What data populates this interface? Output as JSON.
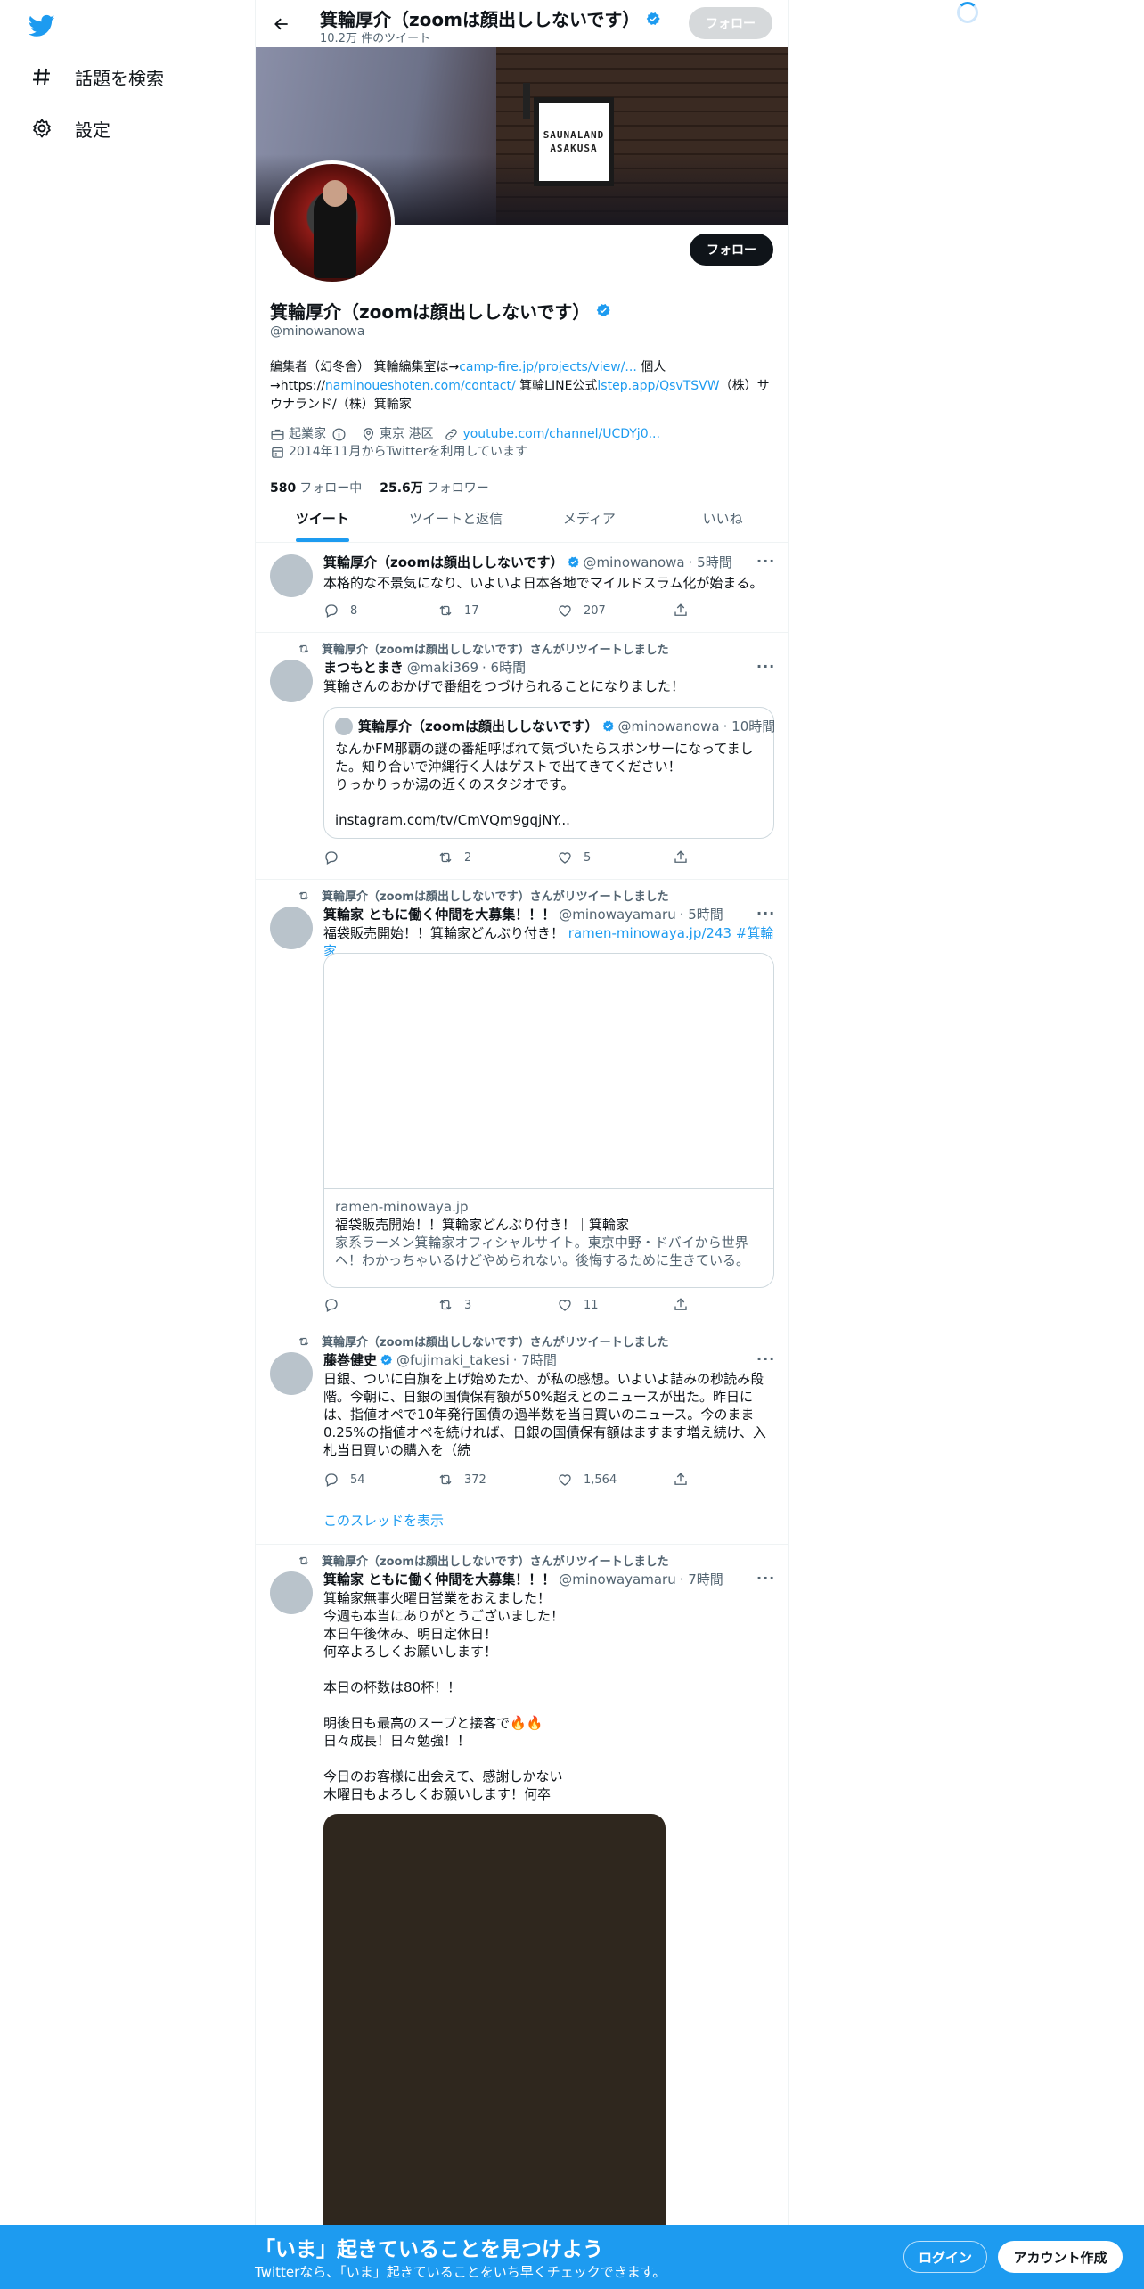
{
  "nav": {
    "items": [
      {
        "label": "話題を検索",
        "icon": "hashtag-icon"
      },
      {
        "label": "設定",
        "icon": "gear-icon"
      }
    ]
  },
  "header": {
    "name": "箕輪厚介（zoomは顔出ししないです）",
    "tweet_count": "10.2万 件のツイート",
    "follow_label": "フォロー"
  },
  "banner": {
    "sign_line1": "SAUNALAND",
    "sign_line2": "ASAKUSA"
  },
  "profile": {
    "follow_label": "フォロー",
    "name": "箕輪厚介（zoomは顔出ししないです）",
    "handle": "@minowanowa",
    "bio": {
      "p1": "編集者（幻冬舎） 箕輪編集室は→",
      "link1": "camp-fire.jp/projects/view/...",
      "p2": " 個人→https://",
      "link2": "naminoueshoten.com/contact/",
      "p3": " 箕輪LINE公式",
      "link3": "lstep.app/QsvTSVW",
      "p4": "（株）サウナランド/（株）箕輪家"
    },
    "category": "起業家",
    "location": "東京 港区",
    "url": "youtube.com/channel/UCDYj0...",
    "joined": "2014年11月からTwitterを利用しています",
    "following_count": "580",
    "following_label": "フォロー中",
    "followers_count": "25.6万",
    "followers_label": "フォロワー"
  },
  "tabs": [
    "ツイート",
    "ツイートと返信",
    "メディア",
    "いいね"
  ],
  "tweets": [
    {
      "name": "箕輪厚介（zoomは顔出ししないです）",
      "handle": "@minowanowa",
      "time": "· 5時間",
      "text": "本格的な不景気になり、いよいよ日本各地でマイルドスラム化が始まる。",
      "replies": "8",
      "retweets": "17",
      "likes": "207"
    },
    {
      "retweeted_by": "箕輪厚介（zoomは顔出ししないです）さんがリツイートしました",
      "name": "まつもとまき",
      "handle": "@maki369",
      "time": "· 6時間",
      "text": "箕輪さんのおかげで番組をつづけられることになりました！",
      "quote": {
        "name": "箕輪厚介（zoomは顔出ししないです）",
        "handle": "@minowanowa",
        "time": "· 10時間",
        "text": "なんかFM那覇の謎の番組呼ばれて気づいたらスポンサーになってました。知り合いで沖縄行く人はゲストで出てきてください！\nりっかりっか湯の近くのスタジオです。\n\ninstagram.com/tv/CmVQm9gqjNY..."
      },
      "replies": "",
      "retweets": "2",
      "likes": "5"
    },
    {
      "retweeted_by": "箕輪厚介（zoomは顔出ししないです）さんがリツイートしました",
      "name": "箕輪家 ともに働く仲間を大募集！！！",
      "handle": "@minowayamaru",
      "time": "· 5時間",
      "text": "福袋販売開始！！箕輪家どんぶり付き！ ",
      "link": "ramen-minowaya.jp/243",
      "hashtag": " #箕輪家",
      "card": {
        "domain": "ramen-minowaya.jp",
        "title": "福袋販売開始！！箕輪家どんぶり付き！｜箕輪家",
        "description": "家系ラーメン箕輪家オフィシャルサイト。東京中野・ドバイから世界へ！わかっちゃいるけどやめられない。後悔するために生きている。"
      },
      "replies": "",
      "retweets": "3",
      "likes": "11"
    },
    {
      "retweeted_by": "箕輪厚介（zoomは顔出ししないです）さんがリツイートしました",
      "name": "藤巻健史",
      "handle": "@fujimaki_takesi",
      "time": "· 7時間",
      "text": "日銀、ついに白旗を上げ始めたか、が私の感想。いよいよ詰みの秒読み段階。今朝に、日銀の国債保有額が50%超えとのニュースが出た。昨日には、指値オペで10年発行国債の過半数を当日買いのニュース。今のまま0.25%の指値オペを続ければ、日銀の国債保有額はますます増え続け、入札当日買いの購入を（続",
      "replies": "54",
      "retweets": "372",
      "likes": "1,564",
      "thread_label": "このスレッドを表示"
    },
    {
      "retweeted_by": "箕輪厚介（zoomは顔出ししないです）さんがリツイートしました",
      "name": "箕輪家 ともに働く仲間を大募集！！！",
      "handle": "@minowayamaru",
      "time": "· 7時間",
      "text": "箕輪家無事火曜日営業をおえました！\n今週も本当にありがとうございました！\n本日午後休み、明日定休日！\n何卒よろしくお願いします！\n\n本日の杯数は80杯！！\n\n明後日も最高のスープと接客で🔥🔥\n日々成長！日々勉強！！\n\n今日のお客様に出会えて、感謝しかない\n木曜日もよろしくお願いします！何卒"
    }
  ],
  "bottom_bar": {
    "headline": "「いま」起きていることを見つけよう",
    "subline": "Twitterなら、「いま」起きていることをいち早くチェックできます。",
    "login_label": "ログイン",
    "signup_label": "アカウント作成"
  },
  "colors": {
    "accent": "#1d9bf0",
    "text": "#0f1419",
    "secondary": "#536471"
  }
}
